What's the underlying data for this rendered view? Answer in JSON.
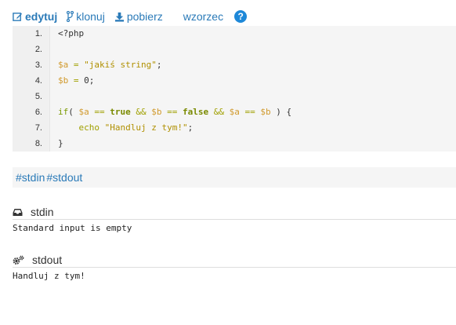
{
  "toolbar": {
    "edit_label": "edytuj",
    "fork_label": "klonuj",
    "download_label": "pobierz",
    "template_label": "wzorzec",
    "help_label": "?"
  },
  "code": {
    "lines": [
      {
        "num": "1.",
        "text": "<?php"
      },
      {
        "num": "2.",
        "text": ""
      },
      {
        "num": "3.",
        "text": "$a = \"jakiś string\";"
      },
      {
        "num": "4.",
        "text": "$b = 0;"
      },
      {
        "num": "5.",
        "text": ""
      },
      {
        "num": "6.",
        "text": "if( $a == true && $b == false && $a == $b ) {"
      },
      {
        "num": "7.",
        "text": "    echo \"Handluj z tym!\";"
      },
      {
        "num": "8.",
        "text": "}"
      }
    ]
  },
  "streams": {
    "stdin_link": "#stdin",
    "stdout_link": "#stdout"
  },
  "stdin": {
    "title": "stdin",
    "content": "Standard input is empty"
  },
  "stdout": {
    "title": "stdout",
    "content": "Handluj z tym!"
  },
  "colors": {
    "link": "#2a7ab8",
    "help_circle": "#1e88d8",
    "code_bg": "#f5f5f5",
    "gutter_bg": "#f0f0f0"
  },
  "icons": {
    "edit": "edit-icon",
    "fork": "fork-icon",
    "download": "download-icon",
    "help": "help-icon",
    "stdin": "inbox-icon",
    "stdout": "gears-icon"
  }
}
